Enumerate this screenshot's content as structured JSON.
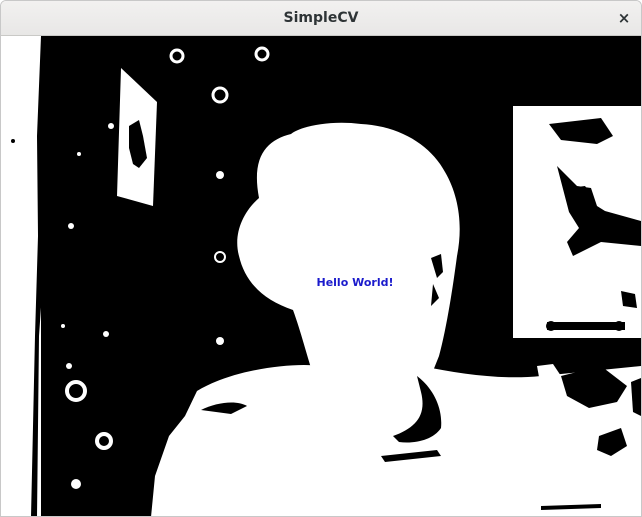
{
  "window": {
    "title": "SimpleCV",
    "close_icon": "close-icon",
    "close_glyph": "×"
  },
  "image": {
    "kind": "binary-threshold camera frame",
    "foreground": "#ffffff",
    "background": "#000000",
    "overlay_text": "Hello World!",
    "overlay_color": "#1a1acc"
  }
}
